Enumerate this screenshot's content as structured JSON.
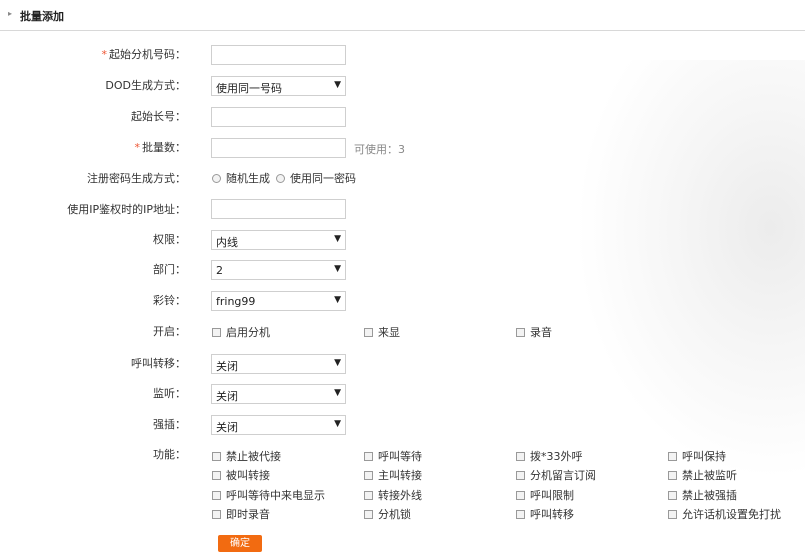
{
  "header": {
    "title": "批量添加"
  },
  "fields": {
    "start_ext": {
      "label": "起始分机号码：",
      "required": true,
      "value": ""
    },
    "dod_mode": {
      "label": "DOD生成方式：",
      "value": "使用同一号码"
    },
    "start_long": {
      "label": "起始长号：",
      "value": ""
    },
    "batch_count": {
      "label": "批量数：",
      "required": true,
      "value": "",
      "hint": "可使用：3"
    },
    "pwd_mode": {
      "label": "注册密码生成方式：",
      "options": [
        "随机生成",
        "使用同一密码"
      ]
    },
    "ip_auth": {
      "label": "使用IP鉴权时的IP地址：",
      "value": ""
    },
    "permission": {
      "label": "权限：",
      "value": "内线"
    },
    "dept": {
      "label": "部门：",
      "value": "2"
    },
    "ringtone": {
      "label": "彩铃：",
      "value": "fring99"
    },
    "enable": {
      "label": "开启：",
      "options": [
        "启用分机",
        "来显",
        "录音"
      ]
    },
    "call_forward": {
      "label": "呼叫转移：",
      "value": "关闭"
    },
    "monitor": {
      "label": "监听：",
      "value": "关闭"
    },
    "barge": {
      "label": "强插：",
      "value": "关闭"
    },
    "functions": {
      "label": "功能：",
      "options": [
        "禁止被代接",
        "呼叫等待",
        "拨*33外呼",
        "呼叫保持",
        "被叫转接",
        "主叫转接",
        "分机留言订阅",
        "禁止被监听",
        "呼叫等待中来电显示",
        "转接外线",
        "呼叫限制",
        "禁止被强插",
        "即时录音",
        "分机锁",
        "呼叫转移",
        "允许话机设置免打扰"
      ]
    }
  },
  "submit": {
    "label": "确定"
  },
  "colors": {
    "accent": "#f26b11",
    "required": "#e53333"
  }
}
